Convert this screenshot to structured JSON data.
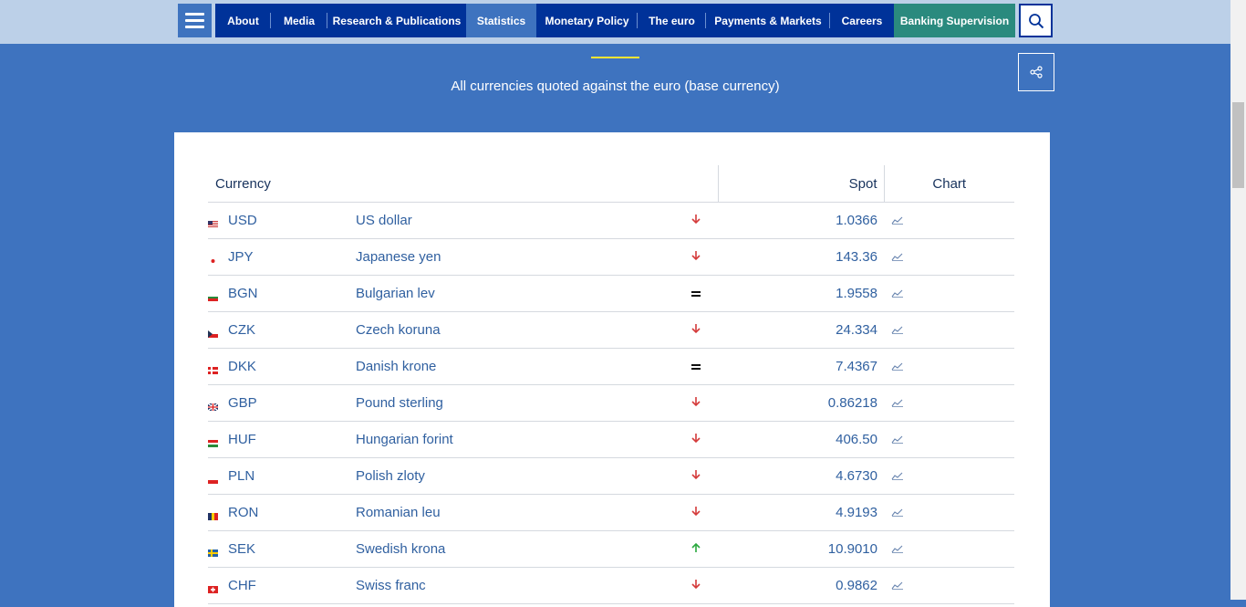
{
  "nav": {
    "items": [
      {
        "label": "About",
        "width": 61
      },
      {
        "label": "Media",
        "width": 62
      },
      {
        "label": "Research & Publications",
        "width": 152
      },
      {
        "label": "Statistics",
        "width": 77,
        "active": true
      },
      {
        "label": "Monetary Policy",
        "width": 111
      },
      {
        "label": "The euro",
        "width": 75
      },
      {
        "label": "Payments & Markets",
        "width": 136
      },
      {
        "label": "Careers",
        "width": 70
      },
      {
        "label": "Banking Supervision",
        "width": 133,
        "highlight": true
      }
    ]
  },
  "header": {
    "subtitle": "All currencies quoted against the euro (base currency)"
  },
  "table": {
    "headers": {
      "currency": "Currency",
      "spot": "Spot",
      "chart": "Chart"
    },
    "rows": [
      {
        "code": "USD",
        "name": "US dollar",
        "trend": "down",
        "spot": "1.0366",
        "flag": "us"
      },
      {
        "code": "JPY",
        "name": "Japanese yen",
        "trend": "down",
        "spot": "143.36",
        "flag": "jp"
      },
      {
        "code": "BGN",
        "name": "Bulgarian lev",
        "trend": "equal",
        "spot": "1.9558",
        "flag": "bg"
      },
      {
        "code": "CZK",
        "name": "Czech koruna",
        "trend": "down",
        "spot": "24.334",
        "flag": "cz"
      },
      {
        "code": "DKK",
        "name": "Danish krone",
        "trend": "equal",
        "spot": "7.4367",
        "flag": "dk"
      },
      {
        "code": "GBP",
        "name": "Pound sterling",
        "trend": "down",
        "spot": "0.86218",
        "flag": "gb"
      },
      {
        "code": "HUF",
        "name": "Hungarian forint",
        "trend": "down",
        "spot": "406.50",
        "flag": "hu"
      },
      {
        "code": "PLN",
        "name": "Polish zloty",
        "trend": "down",
        "spot": "4.6730",
        "flag": "pl"
      },
      {
        "code": "RON",
        "name": "Romanian leu",
        "trend": "down",
        "spot": "4.9193",
        "flag": "ro"
      },
      {
        "code": "SEK",
        "name": "Swedish krona",
        "trend": "up",
        "spot": "10.9010",
        "flag": "se"
      },
      {
        "code": "CHF",
        "name": "Swiss franc",
        "trend": "down",
        "spot": "0.9862",
        "flag": "ch"
      }
    ]
  },
  "colors": {
    "background": "#3e73bf",
    "nav": "#003299",
    "nav_active": "#3e73bf",
    "banking": "#2a8a7e",
    "trend_down": "#d43a3a",
    "trend_up": "#2aa83e"
  }
}
